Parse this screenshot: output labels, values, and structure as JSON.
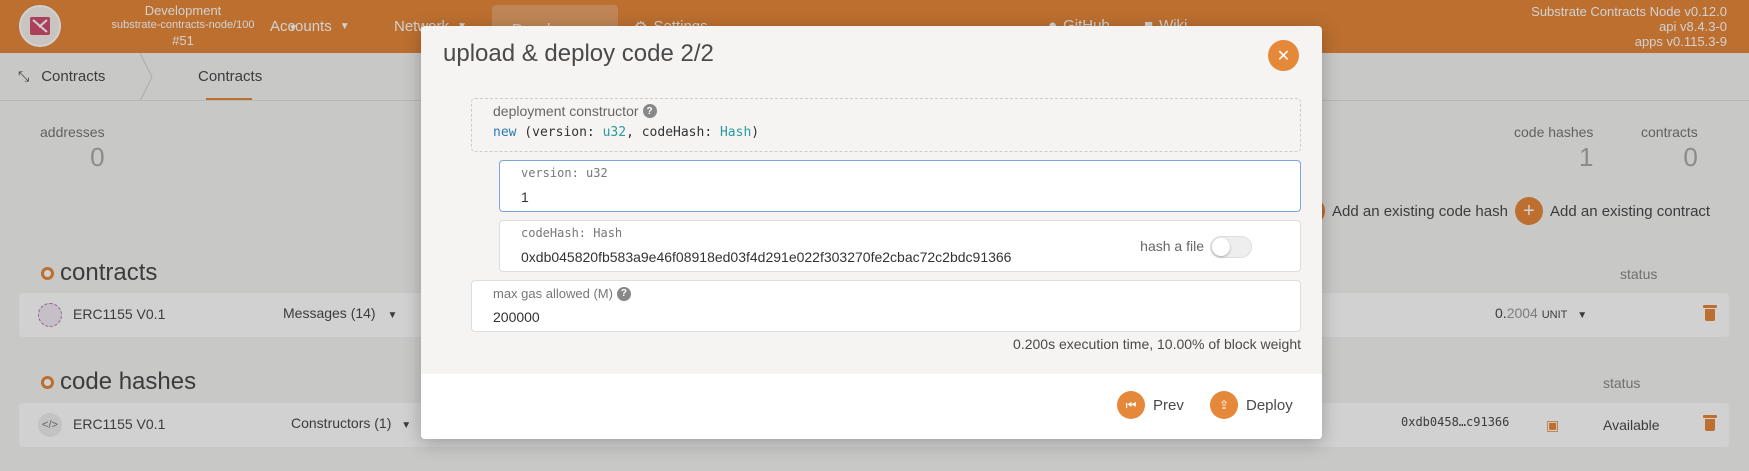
{
  "topbar": {
    "chain_type": "Development",
    "chain_name": "substrate-contracts-node/100",
    "block": "#51",
    "nav": {
      "accounts": "Accounts",
      "network": "Network",
      "developer": "Developer",
      "settings": "Settings",
      "github": "GitHub",
      "wiki": "Wiki"
    },
    "versions": {
      "node": "Substrate Contracts Node v0.12.0",
      "api": "api v8.4.3-0",
      "apps": "apps v0.115.3-9"
    }
  },
  "subbar": {
    "section": "Contracts",
    "tab": "Contracts"
  },
  "page": {
    "stats": {
      "addresses_label": "addresses",
      "addresses_value": "0",
      "code_hashes_label": "code hashes",
      "code_hashes_value": "1",
      "contracts_label": "contracts",
      "contracts_value": "0"
    },
    "actions": {
      "add_code_hash": "Add an existing code hash",
      "add_contract": "Add an existing contract"
    },
    "contracts_section": {
      "title": "contracts",
      "status_header": "status",
      "row": {
        "name": "ERC1155 V0.1",
        "messages": "Messages (14)",
        "balance_int": "0.",
        "balance_frac": "2004",
        "balance_unit": "UNIT"
      }
    },
    "code_hashes_section": {
      "title": "code hashes",
      "status_header": "status",
      "row": {
        "name": "ERC1155 V0.1",
        "constructors": "Constructors (1)",
        "hash_short": "0xdb0458…c91366",
        "status": "Available"
      }
    }
  },
  "modal": {
    "title": "upload & deploy code 2/2",
    "constructor_label": "deployment constructor",
    "constructor_sig": {
      "kw": "new",
      "open": " (version: ",
      "t1": "u32",
      "mid": ", codeHash: ",
      "t2": "Hash",
      "close": ")"
    },
    "version_label": "version: u32",
    "version_value": "1",
    "codehash_label": "codeHash: Hash",
    "codehash_value": "0xdb045820fb583a9e46f08918ed03f4d291e022f303270fe2cbac72c2bdc91366",
    "hash_file_label": "hash a file",
    "hash_file_enabled": false,
    "gas_label": "max gas allowed (M)",
    "gas_value": "200000",
    "exec_info": "0.200s execution time, 10.00% of block weight",
    "prev_label": "Prev",
    "deploy_label": "Deploy"
  },
  "colors": {
    "accent": "#e6883a",
    "background": "#f5f4f3"
  }
}
